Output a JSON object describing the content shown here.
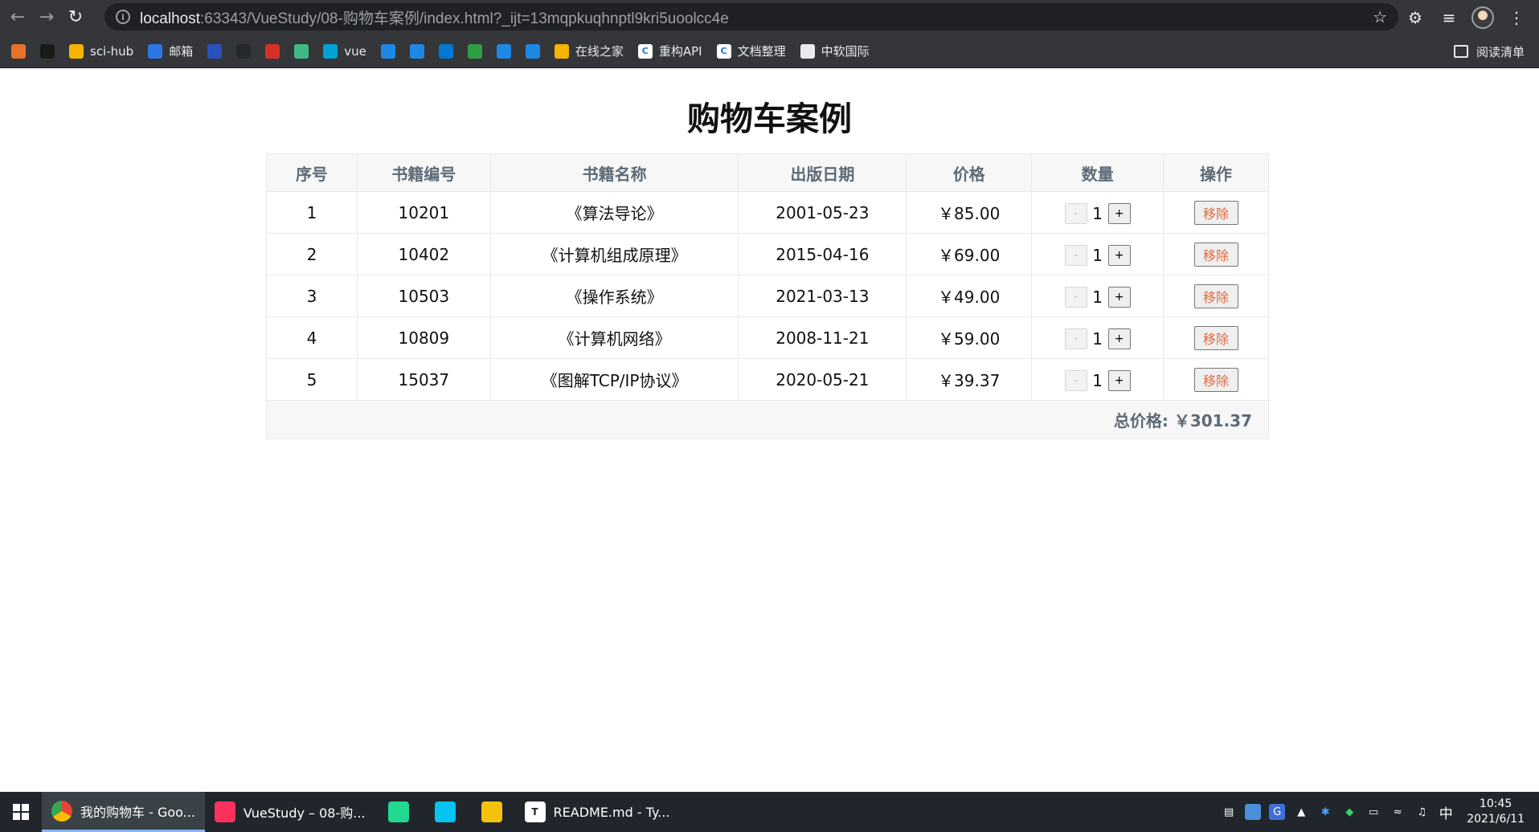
{
  "browser": {
    "url_host": "localhost",
    "url_rest": ":63343/VueStudy/08-购物车案例/index.html?_ijt=13mqpkuqhnptl9kri5uoolcc4e",
    "bookmarks": [
      {
        "label": "",
        "color": "#e8712c",
        "icon": "stack-overflow-icon"
      },
      {
        "label": "",
        "color": "#1a1a1a",
        "icon": "flash-icon"
      },
      {
        "label": "sci-hub",
        "color": "#f4b400",
        "icon": "sci-hub-icon"
      },
      {
        "label": "邮箱",
        "color": "#2b78e4",
        "icon": "mail-icon"
      },
      {
        "label": "",
        "color": "#2a52be",
        "icon": "baidu-icon"
      },
      {
        "label": "",
        "color": "#24292e",
        "icon": "github-icon"
      },
      {
        "label": "",
        "color": "#d93025",
        "icon": "g-icon"
      },
      {
        "label": "",
        "color": "#41b883",
        "icon": "v-icon"
      },
      {
        "label": "vue",
        "color": "#00a1d6",
        "icon": "bilibili-icon"
      },
      {
        "label": "",
        "color": "#1e88e5",
        "icon": "cloud-icon"
      },
      {
        "label": "",
        "color": "#1e88e5",
        "icon": "translate-icon"
      },
      {
        "label": "",
        "color": "#0078d4",
        "icon": "onenote-icon"
      },
      {
        "label": "",
        "color": "#2ea043",
        "icon": "refresh-green-icon"
      },
      {
        "label": "",
        "color": "#1e88e5",
        "icon": "blue-square-icon"
      },
      {
        "label": "",
        "color": "#1e88e5",
        "icon": "blue-square-icon"
      },
      {
        "label": "在线之家",
        "color": "#f4b400",
        "icon": "zxzj-icon"
      },
      {
        "label": "重构API",
        "color": "#ffffff",
        "icon": "c-icon"
      },
      {
        "label": "文档整理",
        "color": "#ffffff",
        "icon": "c-icon"
      },
      {
        "label": "中软国际",
        "color": "#e8eaed",
        "icon": "globe-icon"
      }
    ],
    "reading_list": "阅读清单"
  },
  "page": {
    "title": "购物车案例",
    "headers": [
      "序号",
      "书籍编号",
      "书籍名称",
      "出版日期",
      "价格",
      "数量",
      "操作"
    ],
    "books": [
      {
        "index": "1",
        "code": "10201",
        "name": "《算法导论》",
        "date": "2001-05-23",
        "price": "￥85.00",
        "count": "1"
      },
      {
        "index": "2",
        "code": "10402",
        "name": "《计算机组成原理》",
        "date": "2015-04-16",
        "price": "￥69.00",
        "count": "1"
      },
      {
        "index": "3",
        "code": "10503",
        "name": "《操作系统》",
        "date": "2021-03-13",
        "price": "￥49.00",
        "count": "1"
      },
      {
        "index": "4",
        "code": "10809",
        "name": "《计算机网络》",
        "date": "2008-11-21",
        "price": "￥59.00",
        "count": "1"
      },
      {
        "index": "5",
        "code": "15037",
        "name": "《图解TCP/IP协议》",
        "date": "2020-05-21",
        "price": "￥39.37",
        "count": "1"
      }
    ],
    "minus_label": "-",
    "plus_label": "+",
    "remove_label": "移除",
    "total": "总价格: ￥301.37"
  },
  "taskbar": {
    "items": [
      {
        "label": "我的购物车 - Goo...",
        "color": "#4285f4",
        "icon": "chrome-icon",
        "active": true
      },
      {
        "label": "VueStudy – 08-购...",
        "color": "#fe315d",
        "icon": "intellij-icon",
        "active": false
      },
      {
        "label": "",
        "color": "#22d88f",
        "icon": "datagrip-icon",
        "active": false
      },
      {
        "label": "",
        "color": "#07c3f2",
        "icon": "webstorm-icon",
        "active": false
      },
      {
        "label": "",
        "color": "#f4c20d",
        "icon": "app-yellow-icon",
        "active": false
      },
      {
        "label": "README.md - Ty...",
        "color": "#ffffff",
        "icon": "typora-icon",
        "active": false
      }
    ],
    "ime": "中",
    "time": "10:45",
    "date": "2021/6/11"
  }
}
